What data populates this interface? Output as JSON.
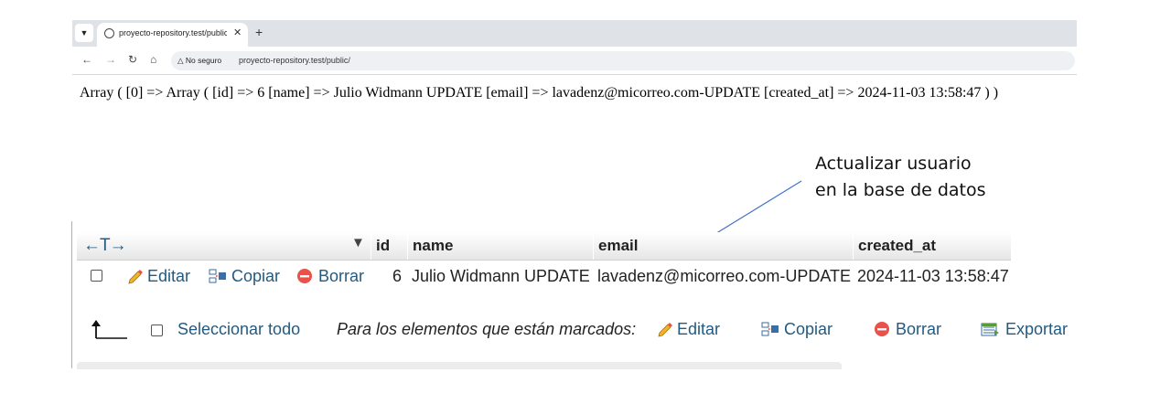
{
  "browser": {
    "tab_title": "proyecto-repository.test/public",
    "tab_close": "✕",
    "new_tab": "+",
    "security_label": "No seguro",
    "url": "proyecto-repository.test/public/"
  },
  "output": {
    "array_text": "Array ( [0] => Array ( [id] => 6 [name] => Julio Widmann UPDATE [email] => lavadenz@micorreo.com-UPDATE [created_at] => 2024-11-03 13:58:47 ) )"
  },
  "annotation": {
    "line1": "Actualizar usuario",
    "line2": "en la base de datos"
  },
  "table": {
    "sort_arrows": "←T→",
    "headers": [
      "id",
      "name",
      "email",
      "created_at"
    ],
    "row": {
      "actions": {
        "edit": "Editar",
        "copy": "Copiar",
        "delete": "Borrar"
      },
      "id": "6",
      "name": "Julio Widmann UPDATE",
      "email": "lavadenz@micorreo.com-UPDATE",
      "created_at": "2024-11-03 13:58:47"
    }
  },
  "footer": {
    "select_all": "Seleccionar todo",
    "marked_label": "Para los elementos que están marcados:",
    "edit": "Editar",
    "copy": "Copiar",
    "delete": "Borrar",
    "export": "Exportar"
  },
  "colors": {
    "link": "#235a81",
    "annotation_arrow": "#4472c4",
    "delete_icon": "#e8524a",
    "edit_icon": "#f0b429"
  }
}
